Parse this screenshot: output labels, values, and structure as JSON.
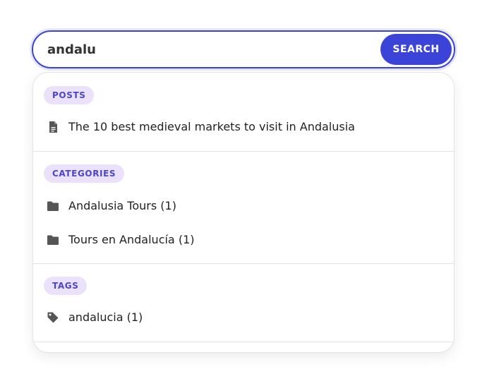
{
  "search": {
    "value": "andalu",
    "button_label": "SEARCH"
  },
  "results": {
    "posts": {
      "title": "POSTS",
      "items": [
        {
          "label": "The 10 best medieval markets to visit in Andalusia",
          "icon": "document-icon"
        }
      ]
    },
    "categories": {
      "title": "CATEGORIES",
      "items": [
        {
          "label": "Andalusia Tours (1)",
          "icon": "folder-icon"
        },
        {
          "label": "Tours en Andalucía (1)",
          "icon": "folder-icon"
        }
      ]
    },
    "tags": {
      "title": "TAGS",
      "items": [
        {
          "label": "andalucia (1)",
          "icon": "tag-icon"
        }
      ]
    }
  },
  "colors": {
    "accent": "#3b44d6",
    "badge_bg": "#ece1fb",
    "badge_text": "#4b46c6",
    "icon": "#555555"
  }
}
